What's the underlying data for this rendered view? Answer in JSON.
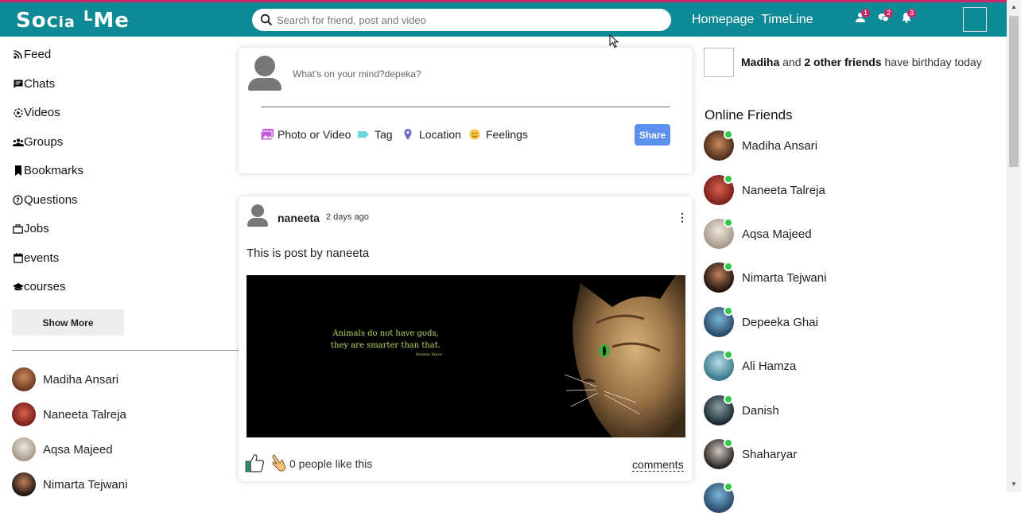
{
  "header": {
    "logo": {
      "part1": "So",
      "part2": "Cia",
      "part3": "L",
      "part4": "Me"
    },
    "search_placeholder": "Search for friend, post and video",
    "links": [
      "Homepage",
      "TimeLine"
    ],
    "notifications": [
      {
        "icon": "person-icon",
        "count": "1"
      },
      {
        "icon": "chat-icon",
        "count": "2"
      },
      {
        "icon": "bell-icon",
        "count": "3"
      }
    ]
  },
  "sidebar": {
    "items": [
      {
        "label": "Feed",
        "icon": "rss-icon"
      },
      {
        "label": "Chats",
        "icon": "chat-icon"
      },
      {
        "label": "Videos",
        "icon": "play-circle-icon"
      },
      {
        "label": "Groups",
        "icon": "group-icon"
      },
      {
        "label": "Bookmarks",
        "icon": "bookmark-icon"
      },
      {
        "label": "Questions",
        "icon": "help-circle-icon"
      },
      {
        "label": "Jobs",
        "icon": "briefcase-icon"
      },
      {
        "label": "events",
        "icon": "calendar-icon"
      },
      {
        "label": "courses",
        "icon": "graduation-cap-icon"
      }
    ],
    "show_more": "Show More",
    "friends": [
      "Madiha Ansari",
      "Naneeta Talreja",
      "Aqsa Majeed",
      "Nimarta Tejwani"
    ]
  },
  "share": {
    "placeholder": "What's on your mind?depeka?",
    "options": [
      "Photo or Video",
      "Tag",
      "Location",
      "Feelings"
    ],
    "share_label": "Share"
  },
  "post": {
    "author": "naneeta",
    "time": "2 days ago",
    "text": "This is post by naneeta",
    "image_quote": [
      "Animals do not have gods,",
      "they are smarter than that."
    ],
    "image_quote_author": "Ronnie Snow",
    "likes": "0 people like this",
    "comments_label": "comments"
  },
  "rightbar": {
    "birthday": {
      "name": "Madiha",
      "and": " and ",
      "others": "2 other friends",
      "suffix": " have birthday today"
    },
    "online_title": "Online Friends",
    "online_friends": [
      "Madiha Ansari",
      "Naneeta Talreja",
      "Aqsa Majeed",
      "Nimarta Tejwani",
      "Depeeka Ghai",
      "Ali Hamza",
      "Danish",
      "Shaharyar"
    ]
  },
  "colors": {
    "header": "#0e8a96",
    "accent_stripe": "#c8296a",
    "share_button": "#5c8ff0",
    "online_dot": "#31c84a"
  }
}
